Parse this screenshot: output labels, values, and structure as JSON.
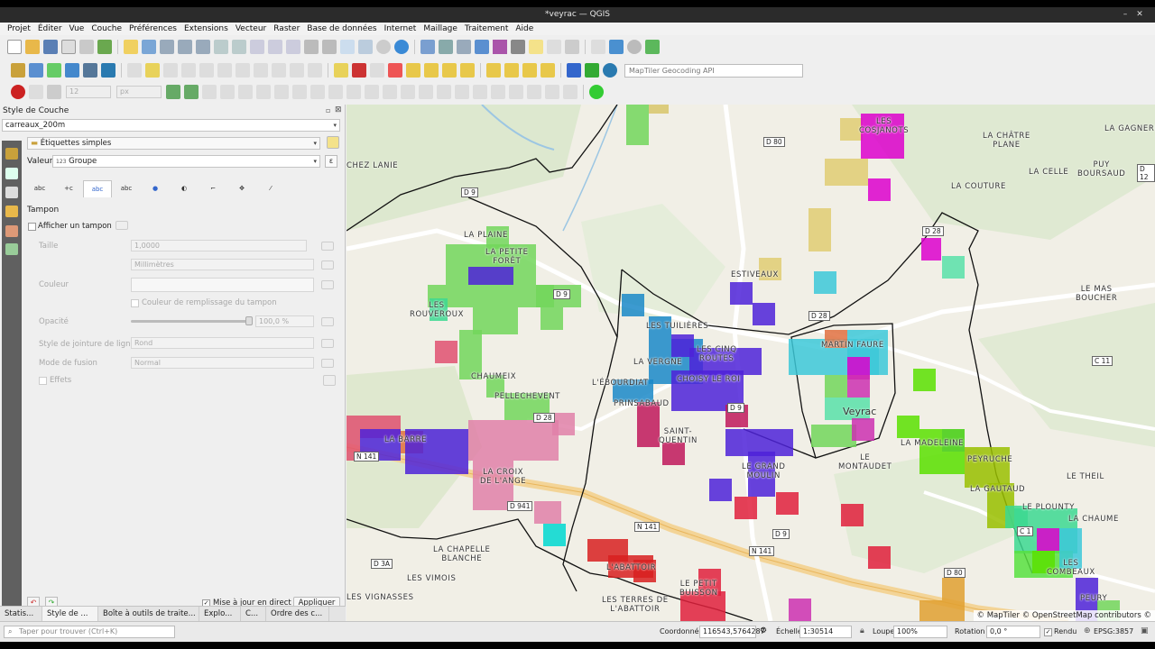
{
  "window": {
    "title": "*veyrac — QGIS"
  },
  "menu": [
    "Projet",
    "Éditer",
    "Vue",
    "Couche",
    "Préférences",
    "Extensions",
    "Vecteur",
    "Raster",
    "Base de données",
    "Internet",
    "Maillage",
    "Traitement",
    "Aide"
  ],
  "toolbar": {
    "geocoding_placeholder": "MapTiler Geocoding API",
    "font_size_value": "12",
    "font_unit": "px"
  },
  "layer_style": {
    "panel_title": "Style de Couche",
    "layer": "carreaux_200m",
    "label_mode": "Étiquettes simples",
    "value_label": "Valeur",
    "value_type_icon": "123",
    "value_field": "Groupe",
    "section": "Tampon",
    "show_buffer": "Afficher un tampon",
    "size_label": "Taille",
    "size_value": "1,0000",
    "unit_value": "Millimètres",
    "color_label": "Couleur",
    "fill_color_label": "Couleur de remplissage du tampon",
    "opacity_label": "Opacité",
    "opacity_value": "100,0 %",
    "join_label": "Style de jointure de ligne",
    "join_value": "Rond",
    "blend_label": "Mode de fusion",
    "blend_value": "Normal",
    "effects_label": "Effets",
    "live_update": "Mise à jour en direct",
    "apply": "Appliquer"
  },
  "dock_tabs": [
    "Statis...",
    "Style de ...",
    "Boîte à outils de traite...",
    "Explo...",
    "C...",
    "Ordre des c..."
  ],
  "search": {
    "placeholder": "Taper pour trouver (Ctrl+K)"
  },
  "map": {
    "places": [
      {
        "name": "LES\nCOSJANOTS"
      },
      {
        "name": "LA CHÂTRE\nPLANE"
      },
      {
        "name": "LA GAGNERI"
      },
      {
        "name": "CHEZ LANIE"
      },
      {
        "name": "LA CELLE"
      },
      {
        "name": "PUY\nBOURSAUD"
      },
      {
        "name": "LA COUTURE"
      },
      {
        "name": "LA PLAINE"
      },
      {
        "name": "LA PETITE\nFORÊT"
      },
      {
        "name": "ESTIVEAUX"
      },
      {
        "name": "LE MAS\nBOUCHER"
      },
      {
        "name": "LES\nROUVEROUX"
      },
      {
        "name": "LES TUILIÈRES"
      },
      {
        "name": "MARTIN FAURE"
      },
      {
        "name": "LES CINQ\nROUTES"
      },
      {
        "name": "LA VERGNE"
      },
      {
        "name": "CHAUMEIX"
      },
      {
        "name": "CHOISY LE ROI"
      },
      {
        "name": "L'ÉBOURDIAT"
      },
      {
        "name": "PELLECHEVENT"
      },
      {
        "name": "PRINSABAUD"
      },
      {
        "name": "LA MADELEINE"
      },
      {
        "name": "SAINT-\nQUENTIN"
      },
      {
        "name": "LA BARRE"
      },
      {
        "name": "PEYRUCHE"
      },
      {
        "name": "LE\nMONTAUDET"
      },
      {
        "name": "LE GRAND\nMOULIN"
      },
      {
        "name": "LE THEIL"
      },
      {
        "name": "LA CROIX\nDE L'ANGE"
      },
      {
        "name": "LA GAUTAUD"
      },
      {
        "name": "LE PLOUNTY"
      },
      {
        "name": "LA CHAUME"
      },
      {
        "name": "LA CHAPELLE\nBLANCHE"
      },
      {
        "name": "LES VIMOIS"
      },
      {
        "name": "L'ABATTOIR"
      },
      {
        "name": "LES\nCOMBEAUX"
      },
      {
        "name": "LE PETIT\nBUISSON"
      },
      {
        "name": "LES VIGNASSES"
      },
      {
        "name": "LES TERRES DE\nL'ABATTOIR"
      },
      {
        "name": "PEURY"
      }
    ],
    "roads": [
      "D 80",
      "D 12",
      "D 9",
      "D 28",
      "D 9",
      "D 28",
      "D 28",
      "C 11",
      "N 141",
      "D 9",
      "C 1",
      "D 941",
      "N 141",
      "D 3A",
      "N 141",
      "D 9",
      "D 80"
    ],
    "town": "Veyrac",
    "attribution": "© MapTiler © OpenStreetMap contributors ©"
  },
  "status": {
    "coord_label": "Coordonnée",
    "coord_value": "116543,5764287",
    "scale_label": "Échelle",
    "scale_value": "1:30514",
    "magnifier_label": "Loupe",
    "magnifier_value": "100%",
    "rotation_label": "Rotation",
    "rotation_value": "0,0 °",
    "render_label": "Rendu",
    "crs": "EPSG:3857"
  }
}
